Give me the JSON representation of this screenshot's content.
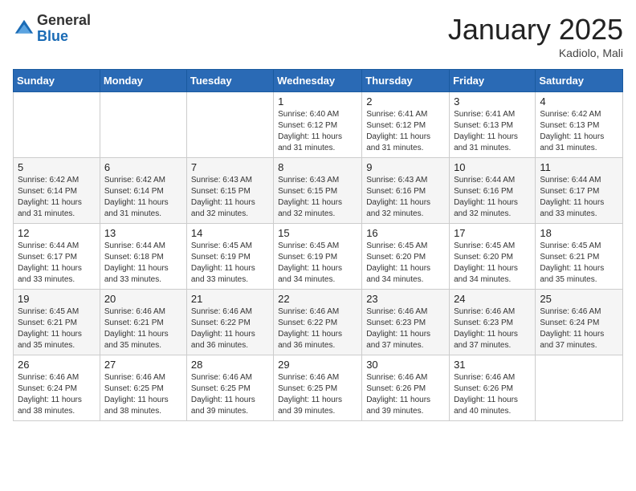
{
  "logo": {
    "general": "General",
    "blue": "Blue"
  },
  "title": "January 2025",
  "location": "Kadiolo, Mali",
  "days_of_week": [
    "Sunday",
    "Monday",
    "Tuesday",
    "Wednesday",
    "Thursday",
    "Friday",
    "Saturday"
  ],
  "weeks": [
    [
      {
        "day": "",
        "info": ""
      },
      {
        "day": "",
        "info": ""
      },
      {
        "day": "",
        "info": ""
      },
      {
        "day": "1",
        "info": "Sunrise: 6:40 AM\nSunset: 6:12 PM\nDaylight: 11 hours\nand 31 minutes."
      },
      {
        "day": "2",
        "info": "Sunrise: 6:41 AM\nSunset: 6:12 PM\nDaylight: 11 hours\nand 31 minutes."
      },
      {
        "day": "3",
        "info": "Sunrise: 6:41 AM\nSunset: 6:13 PM\nDaylight: 11 hours\nand 31 minutes."
      },
      {
        "day": "4",
        "info": "Sunrise: 6:42 AM\nSunset: 6:13 PM\nDaylight: 11 hours\nand 31 minutes."
      }
    ],
    [
      {
        "day": "5",
        "info": "Sunrise: 6:42 AM\nSunset: 6:14 PM\nDaylight: 11 hours\nand 31 minutes."
      },
      {
        "day": "6",
        "info": "Sunrise: 6:42 AM\nSunset: 6:14 PM\nDaylight: 11 hours\nand 31 minutes."
      },
      {
        "day": "7",
        "info": "Sunrise: 6:43 AM\nSunset: 6:15 PM\nDaylight: 11 hours\nand 32 minutes."
      },
      {
        "day": "8",
        "info": "Sunrise: 6:43 AM\nSunset: 6:15 PM\nDaylight: 11 hours\nand 32 minutes."
      },
      {
        "day": "9",
        "info": "Sunrise: 6:43 AM\nSunset: 6:16 PM\nDaylight: 11 hours\nand 32 minutes."
      },
      {
        "day": "10",
        "info": "Sunrise: 6:44 AM\nSunset: 6:16 PM\nDaylight: 11 hours\nand 32 minutes."
      },
      {
        "day": "11",
        "info": "Sunrise: 6:44 AM\nSunset: 6:17 PM\nDaylight: 11 hours\nand 33 minutes."
      }
    ],
    [
      {
        "day": "12",
        "info": "Sunrise: 6:44 AM\nSunset: 6:17 PM\nDaylight: 11 hours\nand 33 minutes."
      },
      {
        "day": "13",
        "info": "Sunrise: 6:44 AM\nSunset: 6:18 PM\nDaylight: 11 hours\nand 33 minutes."
      },
      {
        "day": "14",
        "info": "Sunrise: 6:45 AM\nSunset: 6:19 PM\nDaylight: 11 hours\nand 33 minutes."
      },
      {
        "day": "15",
        "info": "Sunrise: 6:45 AM\nSunset: 6:19 PM\nDaylight: 11 hours\nand 34 minutes."
      },
      {
        "day": "16",
        "info": "Sunrise: 6:45 AM\nSunset: 6:20 PM\nDaylight: 11 hours\nand 34 minutes."
      },
      {
        "day": "17",
        "info": "Sunrise: 6:45 AM\nSunset: 6:20 PM\nDaylight: 11 hours\nand 34 minutes."
      },
      {
        "day": "18",
        "info": "Sunrise: 6:45 AM\nSunset: 6:21 PM\nDaylight: 11 hours\nand 35 minutes."
      }
    ],
    [
      {
        "day": "19",
        "info": "Sunrise: 6:45 AM\nSunset: 6:21 PM\nDaylight: 11 hours\nand 35 minutes."
      },
      {
        "day": "20",
        "info": "Sunrise: 6:46 AM\nSunset: 6:21 PM\nDaylight: 11 hours\nand 35 minutes."
      },
      {
        "day": "21",
        "info": "Sunrise: 6:46 AM\nSunset: 6:22 PM\nDaylight: 11 hours\nand 36 minutes."
      },
      {
        "day": "22",
        "info": "Sunrise: 6:46 AM\nSunset: 6:22 PM\nDaylight: 11 hours\nand 36 minutes."
      },
      {
        "day": "23",
        "info": "Sunrise: 6:46 AM\nSunset: 6:23 PM\nDaylight: 11 hours\nand 37 minutes."
      },
      {
        "day": "24",
        "info": "Sunrise: 6:46 AM\nSunset: 6:23 PM\nDaylight: 11 hours\nand 37 minutes."
      },
      {
        "day": "25",
        "info": "Sunrise: 6:46 AM\nSunset: 6:24 PM\nDaylight: 11 hours\nand 37 minutes."
      }
    ],
    [
      {
        "day": "26",
        "info": "Sunrise: 6:46 AM\nSunset: 6:24 PM\nDaylight: 11 hours\nand 38 minutes."
      },
      {
        "day": "27",
        "info": "Sunrise: 6:46 AM\nSunset: 6:25 PM\nDaylight: 11 hours\nand 38 minutes."
      },
      {
        "day": "28",
        "info": "Sunrise: 6:46 AM\nSunset: 6:25 PM\nDaylight: 11 hours\nand 39 minutes."
      },
      {
        "day": "29",
        "info": "Sunrise: 6:46 AM\nSunset: 6:25 PM\nDaylight: 11 hours\nand 39 minutes."
      },
      {
        "day": "30",
        "info": "Sunrise: 6:46 AM\nSunset: 6:26 PM\nDaylight: 11 hours\nand 39 minutes."
      },
      {
        "day": "31",
        "info": "Sunrise: 6:46 AM\nSunset: 6:26 PM\nDaylight: 11 hours\nand 40 minutes."
      },
      {
        "day": "",
        "info": ""
      }
    ]
  ]
}
